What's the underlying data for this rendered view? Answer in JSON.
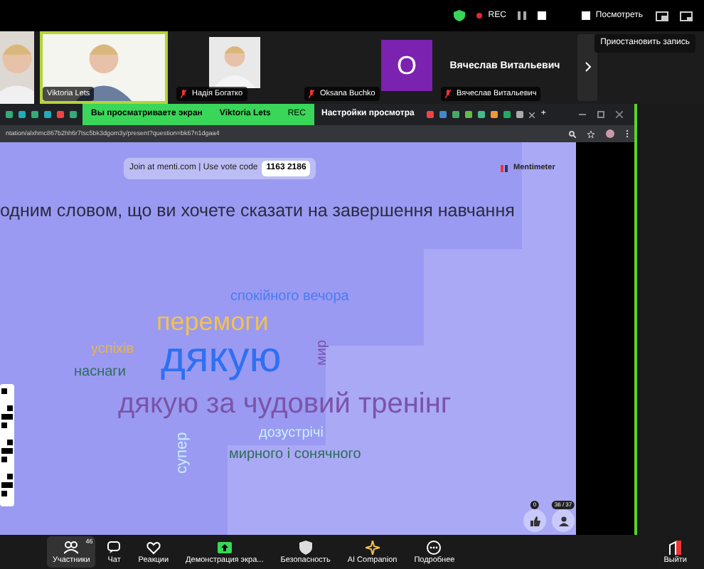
{
  "top_bar": {
    "rec_label": "REC",
    "view_button": "Посмотреть"
  },
  "tooltip": "Приостановить запись",
  "participants": [
    {
      "kind": "video",
      "speaking": false
    },
    {
      "kind": "video",
      "name": "Viktoria Lets",
      "speaking": true,
      "muted": false
    },
    {
      "kind": "video",
      "name": "Надія Богатко",
      "speaking": false,
      "muted": true
    },
    {
      "kind": "avatar",
      "initial": "O",
      "name": "Oksana Buchko",
      "speaking": false,
      "muted": true
    },
    {
      "kind": "name",
      "title": "Вячеслав Витальевич",
      "name": "Вячеслав Витальевич",
      "speaking": false,
      "muted": true
    }
  ],
  "viewing_banner": {
    "text": "Вы просматриваете экран",
    "presenter": "Viktoria Lets",
    "rec_label": "REC",
    "settings": "Настройки просмотра"
  },
  "browser": {
    "url": "ntation/alxhmc867b2hh6r7tsc5bk3dgom3y/present?question=bk67n1dgaa4",
    "new_tab": "+"
  },
  "slide": {
    "join_text": "Join at menti.com | Use vote code",
    "vote_code": "1163 2186",
    "brand": "Mentimeter",
    "question": "одним словом, що ви хочете сказати на завершення навчання",
    "words": [
      {
        "text": "спокійного вечора",
        "color": "#4b7bf0",
        "kind": "horizontal"
      },
      {
        "text": "перемоги",
        "color": "#f2c14e",
        "kind": "horizontal"
      },
      {
        "text": "успіхів",
        "color": "#e8b44f",
        "kind": "horizontal"
      },
      {
        "text": "наснаги",
        "color": "#2f6b5a",
        "kind": "horizontal"
      },
      {
        "text": "дякую",
        "color": "#2f6ff2",
        "kind": "horizontal"
      },
      {
        "text": "мир",
        "color": "#7a54a8",
        "kind": "vertical"
      },
      {
        "text": "дякую за чудовий тренінг",
        "color": "#7a54a8",
        "kind": "horizontal"
      },
      {
        "text": "супер",
        "color": "#c7eeff",
        "kind": "vertical"
      },
      {
        "text": "дозустрічі",
        "color": "#c8f0ff",
        "kind": "horizontal"
      },
      {
        "text": "мирного і сонячного",
        "color": "#2d6b57",
        "kind": "horizontal"
      }
    ],
    "reactions": [
      {
        "kind": "like",
        "count": "0"
      },
      {
        "kind": "people",
        "count": "36 / 37"
      }
    ]
  },
  "toolbar": [
    {
      "kind": "participants",
      "label": "Участники",
      "badge": "46",
      "selected": true
    },
    {
      "kind": "chat",
      "label": "Чат",
      "selected": false
    },
    {
      "kind": "reactions",
      "label": "Реакции",
      "selected": false
    },
    {
      "kind": "share",
      "label": "Демонстрация экра...",
      "selected": false
    },
    {
      "kind": "security",
      "label": "Безопасность",
      "selected": false
    },
    {
      "kind": "ai",
      "label": "AI Companion",
      "selected": false
    },
    {
      "kind": "more",
      "label": "Подробнее",
      "selected": false
    },
    {
      "kind": "leave",
      "label": "Выйти",
      "selected": false
    }
  ]
}
